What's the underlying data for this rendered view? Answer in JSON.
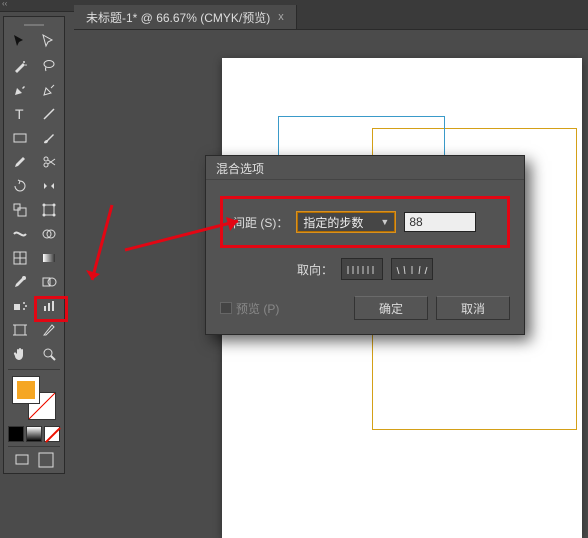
{
  "tab": {
    "title": "未标题-1* @ 66.67% (CMYK/预览)",
    "close_glyph": "x"
  },
  "dialog": {
    "title": "混合选项",
    "spacing_label": "间距 (S)：",
    "spacing_mode": "指定的步数",
    "spacing_value": "88",
    "orientation_label": "取向：",
    "preview_label": "预览 (P)",
    "ok_label": "确定",
    "cancel_label": "取消"
  },
  "swatch": {
    "active_fill": "#f5a623"
  },
  "colors": {
    "accent_red": "#e30613",
    "panel_bg": "#535353"
  }
}
